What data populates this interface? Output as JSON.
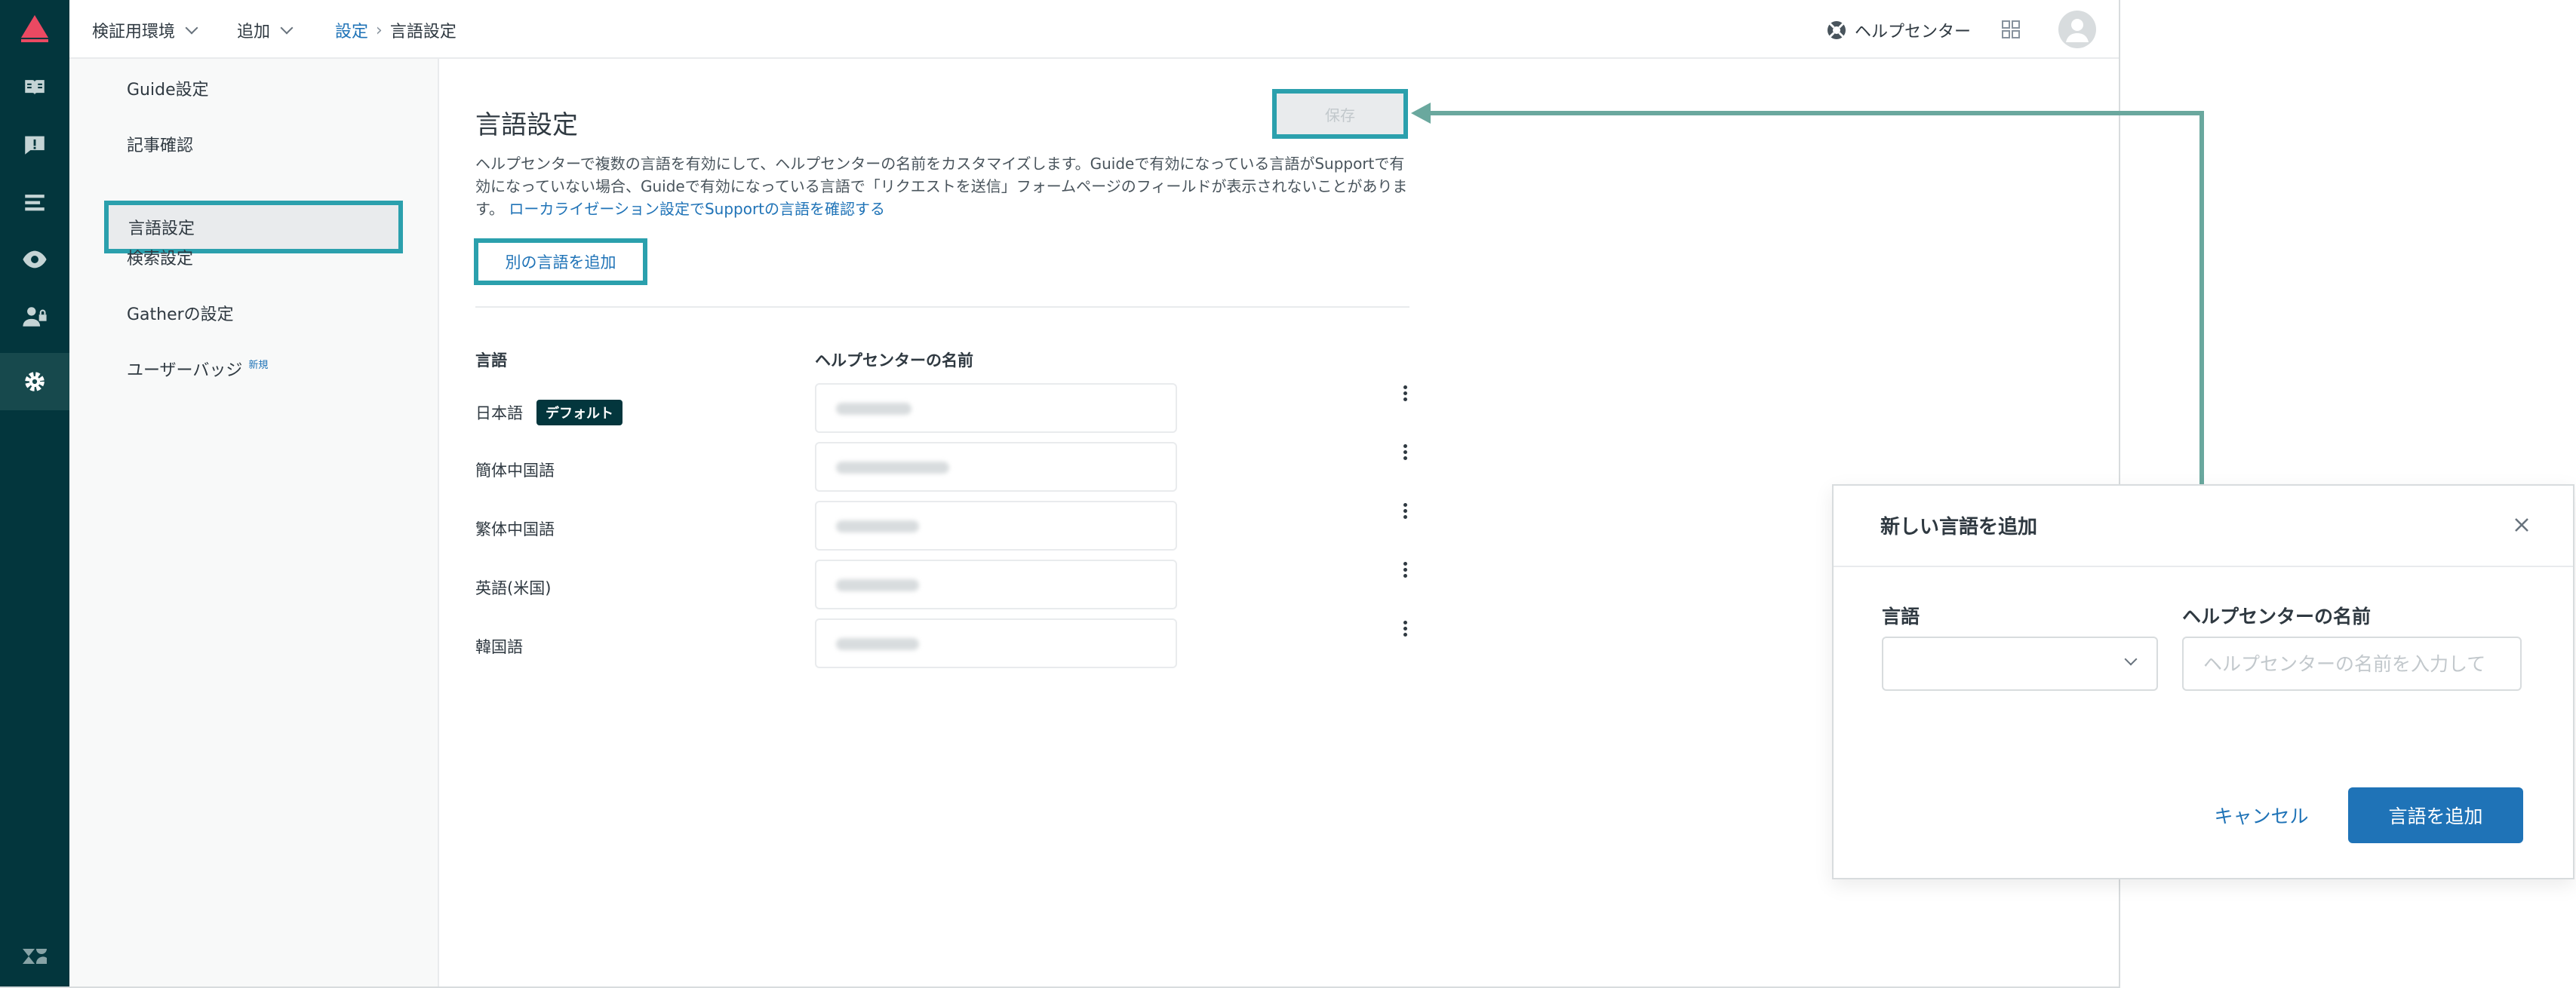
{
  "rail": {
    "items": [
      {
        "icon": "book-icon"
      },
      {
        "icon": "alert-icon"
      },
      {
        "icon": "list-icon"
      },
      {
        "icon": "eye-icon"
      },
      {
        "icon": "user-lock-icon"
      },
      {
        "icon": "gear-icon",
        "active": true
      }
    ],
    "bottom_icon": "zendesk-logo-icon"
  },
  "topbar": {
    "env": "検証用環境",
    "add": "追加",
    "breadcrumb": {
      "parent": "設定",
      "separator": "›",
      "current": "言語設定"
    },
    "help": "ヘルプセンター"
  },
  "subnav": {
    "items": [
      {
        "label": "Guide設定"
      },
      {
        "label": "記事確認"
      },
      {
        "label": "言語設定",
        "active": true
      },
      {
        "label": "検索設定"
      },
      {
        "label": "Gatherの設定"
      },
      {
        "label": "ユーザーバッジ",
        "tag": "新規"
      }
    ]
  },
  "main": {
    "title": "言語設定",
    "description": "ヘルプセンターで複数の言語を有効にして、ヘルプセンターの名前をカスタマイズします。Guideで有効になっている言語がSupportで有効になっていない場合、Guideで有効になっている言語で「リクエストを送信」フォームページのフィールドが表示されないことがあります。",
    "description_link": "ローカライゼーション設定でSupportの言語を確認する",
    "save_label": "保存",
    "add_language_label": "別の言語を追加",
    "columns": {
      "language": "言語",
      "name": "ヘルプセンターの名前"
    },
    "languages": [
      {
        "name": "日本語",
        "badge": "デフォルト"
      },
      {
        "name": "簡体中国語"
      },
      {
        "name": "繁体中国語"
      },
      {
        "name": "英語(米国)"
      },
      {
        "name": "韓国語"
      }
    ]
  },
  "modal": {
    "title": "新しい言語を追加",
    "language_label": "言語",
    "name_label": "ヘルプセンターの名前",
    "name_placeholder": "ヘルプセンターの名前を入力して",
    "cancel_label": "キャンセル",
    "submit_label": "言語を追加"
  },
  "colors": {
    "rail": "#03363d",
    "highlight": "#2ba0ad",
    "link": "#1f73b7",
    "arrow": "#6aa89e"
  }
}
